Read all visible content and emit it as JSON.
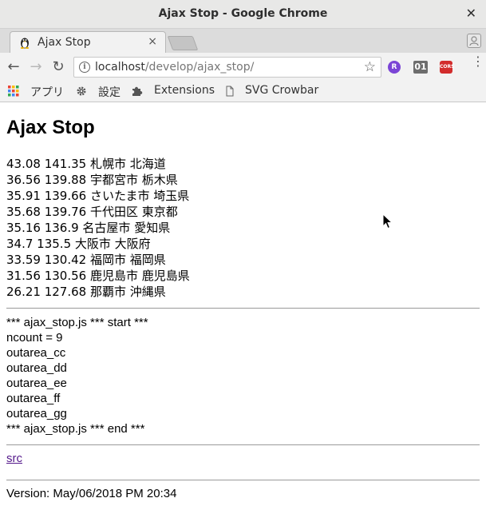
{
  "window": {
    "title": "Ajax Stop - Google Chrome",
    "close_glyph": "✕"
  },
  "tab": {
    "title": "Ajax Stop",
    "close_glyph": "×"
  },
  "toolbar": {
    "back_glyph": "←",
    "forward_glyph": "→",
    "reload_glyph": "↻",
    "url_host": "localhost",
    "url_path": "/develop/ajax_stop/",
    "info_glyph": "i",
    "star_glyph": "☆",
    "ext_r": "R",
    "ext_01": "01",
    "ext_cors": "CORS",
    "menu_glyph": "⋮"
  },
  "bookmarks": {
    "apps": "アプリ",
    "settings": "設定",
    "extensions": "Extensions",
    "svg_crowbar": "SVG Crowbar"
  },
  "page": {
    "heading": "Ajax Stop",
    "rows": [
      "43.08 141.35 札幌市 北海道",
      "36.56 139.88 宇都宮市 栃木県",
      "35.91 139.66 さいたま市 埼玉県",
      "35.68 139.76 千代田区 東京都",
      "35.16 136.9 名古屋市 愛知県",
      "34.7 135.5 大阪市 大阪府",
      "33.59 130.42 福岡市 福岡県",
      "31.56 130.56 鹿児島市 鹿児島県",
      "26.21 127.68 那覇市 沖縄県"
    ],
    "log": [
      "*** ajax_stop.js *** start ***",
      "ncount = 9",
      "outarea_cc",
      "outarea_dd",
      "outarea_ee",
      "outarea_ff",
      "outarea_gg",
      "*** ajax_stop.js *** end ***"
    ],
    "src_link": "src",
    "version": "Version: May/06/2018 PM 20:34"
  },
  "colors": {
    "link_visited": "#551a8b",
    "rule": "#9a9a9a",
    "chrome_bg": "#f2f2f2"
  }
}
